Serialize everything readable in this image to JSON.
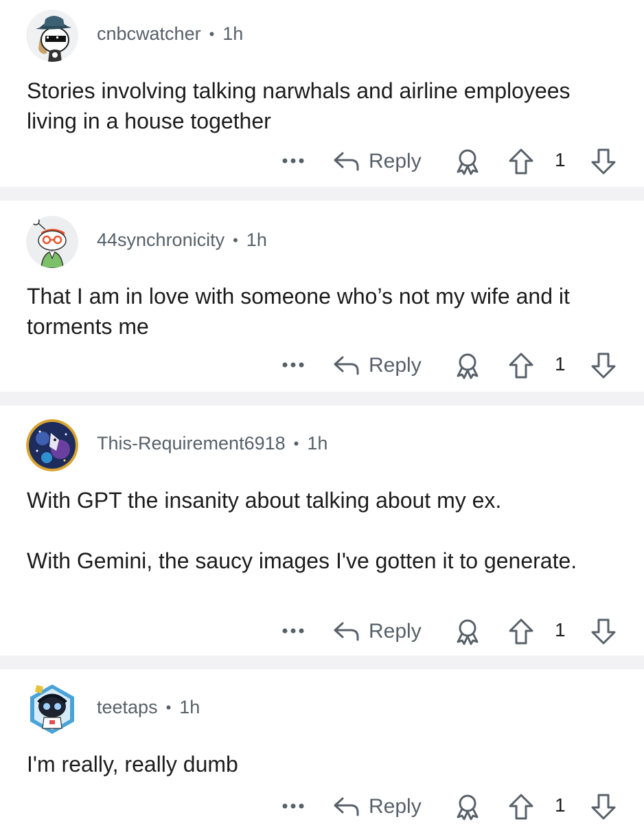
{
  "comments": [
    {
      "username": "cnbcwatcher",
      "time": "1h",
      "body": [
        "Stories involving talking narwhals and airline employees living in a house together"
      ],
      "reply_label": "Reply",
      "score": "1"
    },
    {
      "username": "44synchronicity",
      "time": "1h",
      "body": [
        "That I am in love with someone who’s not my wife and it torments me"
      ],
      "reply_label": "Reply",
      "score": "1"
    },
    {
      "username": "This-Requirement6918",
      "time": "1h",
      "body": [
        "With GPT the insanity about talking about my ex.",
        "With Gemini, the saucy images I've gotten it to generate."
      ],
      "reply_label": "Reply",
      "score": "1"
    },
    {
      "username": "teetaps",
      "time": "1h",
      "body": [
        "I'm really, really dumb"
      ],
      "reply_label": "Reply",
      "score": "1"
    }
  ],
  "icons": {
    "more": "more-horizontal-icon",
    "reply": "reply-arrow-icon",
    "award": "award-ribbon-icon",
    "upvote": "upvote-arrow-icon",
    "downvote": "downvote-arrow-icon"
  },
  "colors": {
    "text": "#1c1c1c",
    "meta": "#576069",
    "divider": "#f2f2f4",
    "background": "#ffffff"
  }
}
